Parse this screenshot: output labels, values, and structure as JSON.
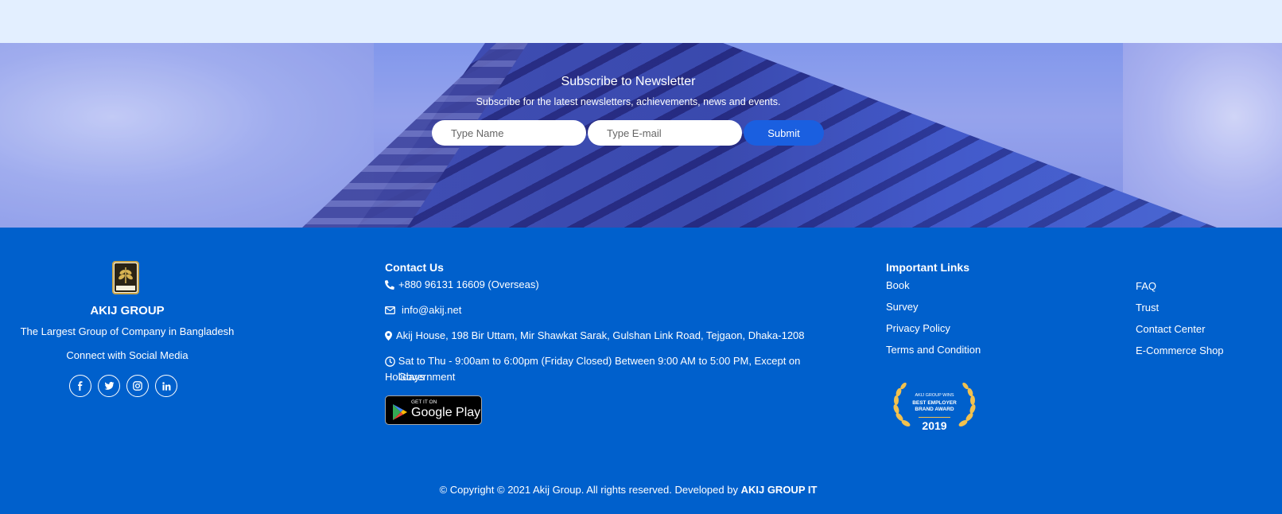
{
  "newsletter": {
    "title": "Subscribe to Newsletter",
    "subtitle": "Subscribe for the latest newsletters, achievements, news and events.",
    "name_placeholder": "Type Name",
    "email_placeholder": "Type E-mail",
    "submit_label": "Submit"
  },
  "brand": {
    "logo_text": "AKIJ GROUP",
    "name": "AKIJ GROUP",
    "tagline": "The Largest Group of Company in Bangladesh",
    "connect_label": "Connect with Social Media",
    "socials": [
      "facebook-icon",
      "twitter-icon",
      "instagram-icon",
      "linkedin-icon"
    ]
  },
  "contact": {
    "title": "Contact Us",
    "phone": "+880 96131 16609 (Overseas)",
    "email": "info@akij.net",
    "address": "Akij House, 198 Bir Uttam, Mir Shawkat Sarak, Gulshan Link Road, Tejgaon, Dhaka-1208",
    "hours_line1": "Sat to Thu - 9:00am to 6:00pm (Friday Closed) Between 9:00 AM to 5:00 PM, Except on Government",
    "hours_line2": "Holidays",
    "store_badge_small": "GET IT ON",
    "store_badge_big": "Google Play"
  },
  "links": {
    "title": "Important Links",
    "col1": [
      "Book",
      "Survey",
      "Privacy Policy",
      "Terms and Condition"
    ],
    "col2": [
      "FAQ",
      "Trust",
      "Contact Center",
      "E-Commerce Shop"
    ],
    "award": {
      "line1": "AKIJ GROUP WINS",
      "line2": "BEST EMPLOYER",
      "line3": "BRAND AWARD",
      "year": "2019"
    }
  },
  "footer": {
    "copyright": "© Copyright © 2021 Akij Group. All rights reserved. Developed by",
    "developer": "AKIJ GROUP IT"
  },
  "colors": {
    "footer_bg": "#0060cc",
    "top_strip": "#e3efff",
    "submit_bg": "#1a5fe0",
    "award_gold": "#f2c14e"
  }
}
